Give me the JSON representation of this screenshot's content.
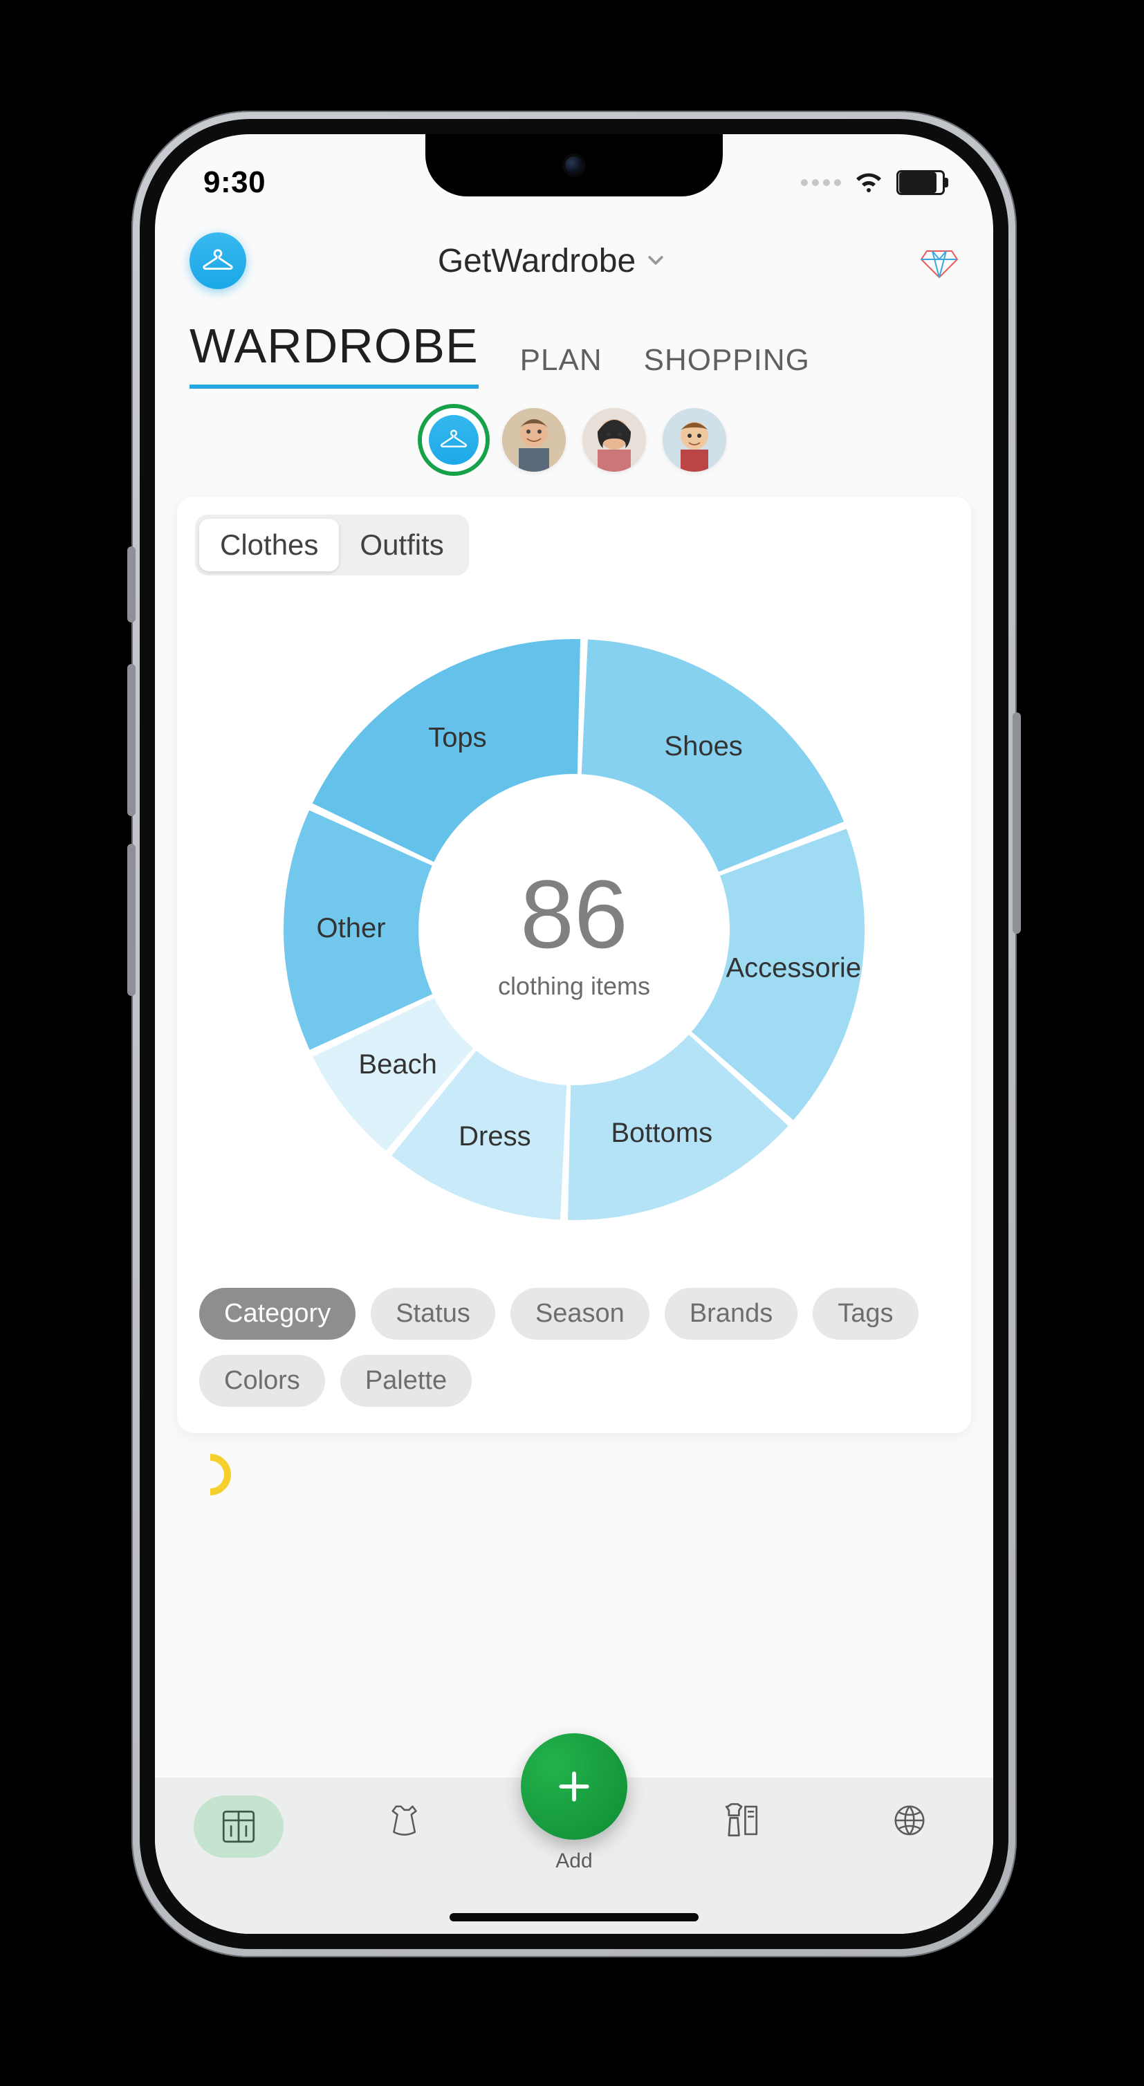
{
  "status": {
    "time": "9:30"
  },
  "header": {
    "title": "GetWardrobe",
    "diamond_icon": "diamond-icon"
  },
  "tabs": {
    "active": 0,
    "items": [
      "WARDROBE",
      "PLAN",
      "SHOPPING"
    ]
  },
  "profiles": {
    "selected": 0,
    "items": [
      "hanger",
      "person-1",
      "person-2",
      "person-3"
    ]
  },
  "segmented": {
    "active": 0,
    "items": [
      "Clothes",
      "Outfits"
    ]
  },
  "donut": {
    "total": "86",
    "subtitle": "clothing items"
  },
  "chart_data": {
    "type": "pie",
    "title": "clothing items",
    "total": 86,
    "categories": [
      "Tops",
      "Shoes",
      "Accessorie",
      "Bottoms",
      "Dress",
      "Beach",
      "Other"
    ],
    "values": [
      16,
      16,
      15,
      12,
      9,
      6,
      12
    ],
    "colors": [
      "#64c2ea",
      "#86d0f0",
      "#a0dbf4",
      "#b4e3f7",
      "#c8eaf9",
      "#ddf2fb",
      "#72c8ec"
    ]
  },
  "filters": {
    "active": 0,
    "items": [
      "Category",
      "Status",
      "Season",
      "Brands",
      "Tags",
      "Colors",
      "Palette"
    ]
  },
  "bottom_nav": {
    "add_label": "Add",
    "items": [
      "wardrobe",
      "dress",
      "add",
      "outfit",
      "globe"
    ],
    "active": 0
  }
}
